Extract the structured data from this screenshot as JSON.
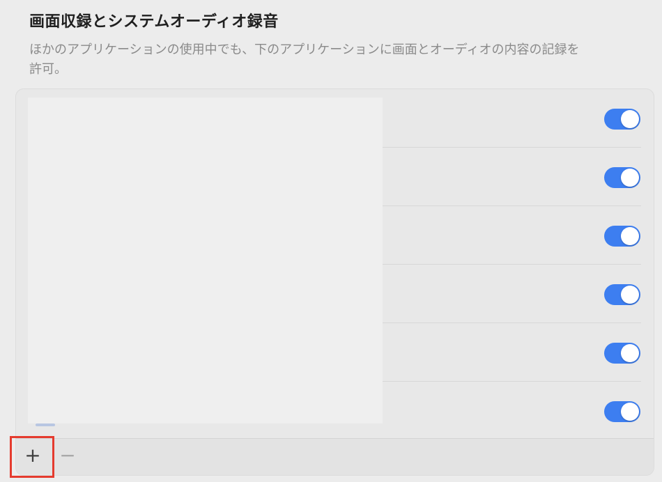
{
  "section": {
    "title": "画面収録とシステムオーディオ録音",
    "description": "ほかのアプリケーションの使用中でも、下のアプリケーションに画面とオーディオの内容の記録を許可。"
  },
  "apps": [
    {
      "enabled": true
    },
    {
      "enabled": true
    },
    {
      "enabled": true
    },
    {
      "enabled": true
    },
    {
      "enabled": true
    },
    {
      "enabled": true
    }
  ],
  "footer": {
    "add_label": "+",
    "remove_label": "−"
  },
  "colors": {
    "toggle_on": "#3d7ef0",
    "highlight": "#e53b2e"
  }
}
